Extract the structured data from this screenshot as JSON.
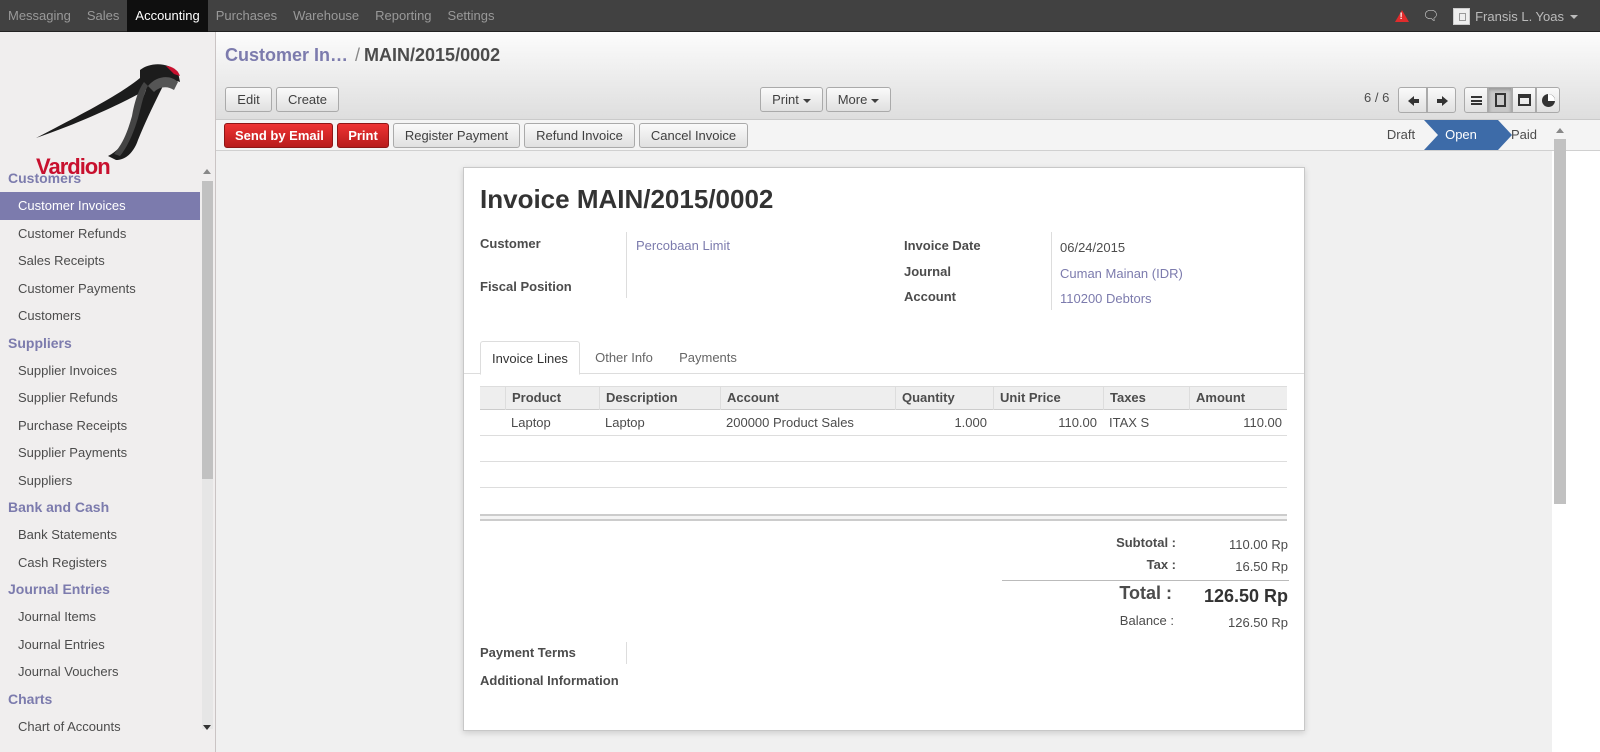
{
  "topbar": {
    "menu": [
      "Messaging",
      "Sales",
      "Accounting",
      "Purchases",
      "Warehouse",
      "Reporting",
      "Settings"
    ],
    "active": "Accounting",
    "user_name": "Fransis L. Yoas",
    "icons": [
      "warning-icon",
      "chat-icon",
      "avatar-icon"
    ],
    "alert_color": "#e02c2c"
  },
  "brand": {
    "name": "Vardion",
    "color": "#c8102e"
  },
  "sidebar": {
    "sections": [
      {
        "title": "Customers",
        "items": [
          "Customer Invoices",
          "Customer Refunds",
          "Sales Receipts",
          "Customer Payments",
          "Customers"
        ]
      },
      {
        "title": "Suppliers",
        "items": [
          "Supplier Invoices",
          "Supplier Refunds",
          "Purchase Receipts",
          "Supplier Payments",
          "Suppliers"
        ]
      },
      {
        "title": "Bank and Cash",
        "items": [
          "Bank Statements",
          "Cash Registers"
        ]
      },
      {
        "title": "Journal Entries",
        "items": [
          "Journal Items",
          "Journal Entries",
          "Journal Vouchers"
        ]
      },
      {
        "title": "Charts",
        "items": [
          "Chart of Accounts"
        ]
      }
    ],
    "active_item": "Customer Invoices",
    "accent_color": "#7c7bad"
  },
  "breadcrumb": {
    "parent": "Customer In…",
    "separator": "/",
    "current": "MAIN/2015/0002"
  },
  "toolbar": {
    "edit": "Edit",
    "create": "Create",
    "print": "Print",
    "more": "More"
  },
  "pager": {
    "text": "6 / 6"
  },
  "statusbar": {
    "buttons": [
      "Send by Email",
      "Print",
      "Register Payment",
      "Refund Invoice",
      "Cancel Invoice"
    ],
    "stages": [
      "Draft",
      "Open",
      "Paid"
    ],
    "current_stage": "Open",
    "stage_color": "#3d6ba8"
  },
  "invoice": {
    "title": "Invoice MAIN/2015/0002",
    "labels": {
      "customer": "Customer",
      "fiscal_position": "Fiscal Position",
      "invoice_date": "Invoice Date",
      "journal": "Journal",
      "account": "Account",
      "payment_terms": "Payment Terms",
      "additional_info": "Additional Information"
    },
    "customer": "Percobaan Limit",
    "invoice_date": "06/24/2015",
    "journal": "Cuman Mainan (IDR)",
    "account": "110200 Debtors",
    "tabs": [
      "Invoice Lines",
      "Other Info",
      "Payments"
    ],
    "active_tab": "Invoice Lines",
    "lines": {
      "headers": [
        "Product",
        "Description",
        "Account",
        "Quantity",
        "Unit Price",
        "Taxes",
        "Amount"
      ],
      "rows": [
        [
          "Laptop",
          "Laptop",
          "200000 Product Sales",
          "1.000",
          "110.00",
          "ITAX S",
          "110.00"
        ]
      ]
    },
    "totals": {
      "subtotal_label": "Subtotal :",
      "subtotal": "110.00 Rp",
      "tax_label": "Tax :",
      "tax": "16.50 Rp",
      "total_label": "Total :",
      "total": "126.50 Rp",
      "balance_label": "Balance :",
      "balance": "126.50 Rp"
    }
  }
}
